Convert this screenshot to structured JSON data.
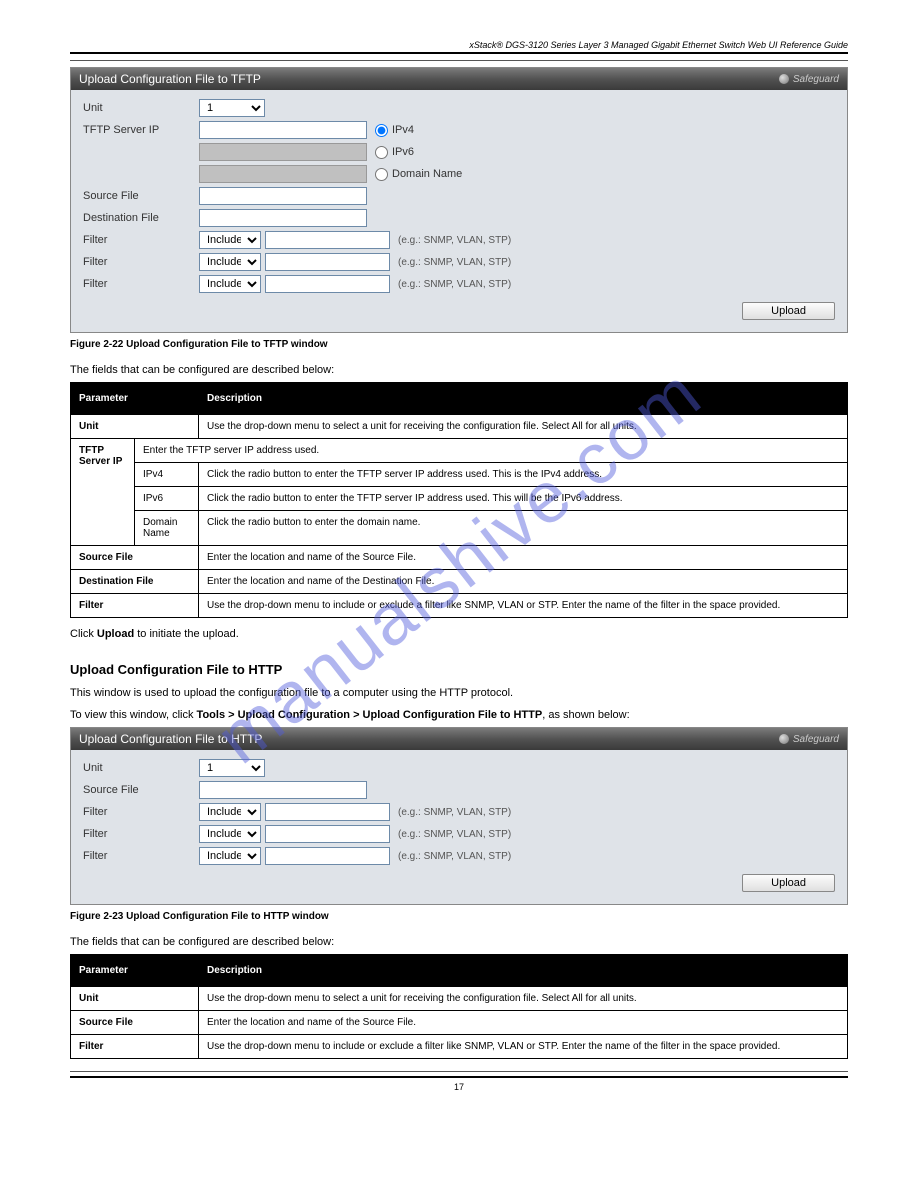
{
  "header": "xStack® DGS-3120 Series Layer 3 Managed Gigabit Ethernet Switch Web UI Reference Guide",
  "watermark": "manualshive.com",
  "panel1": {
    "title": "Upload Configuration File to TFTP",
    "safeguard": "Safeguard",
    "labels": {
      "unit": "Unit",
      "server": "TFTP Server IP",
      "src": "Source File",
      "dest": "Destination File",
      "filter": "Filter"
    },
    "unit_value": "1",
    "radios": {
      "ipv4": "IPv4",
      "ipv6": "IPv6",
      "domain": "Domain Name"
    },
    "filter_sel": "Include",
    "hint": "(e.g.: SNMP, VLAN, STP)",
    "btn": "Upload"
  },
  "figcap1": "Figure 2-22 Upload Configuration File to TFTP window",
  "desc1": "The fields that can be configured are described below:",
  "table1": {
    "h1": "Parameter",
    "h2": "Description",
    "r_unit_p": "Unit",
    "r_unit_d": "Use the drop-down menu to select a unit for receiving the configuration file. Select All for all units.",
    "r_srv_p": "TFTP Server IP",
    "r_srv_d": "Enter the TFTP server IP address used.",
    "r_ipv4_p": "IPv4",
    "r_ipv4_d": "Click the radio button to enter the TFTP server IP address used. This is the IPv4 address.",
    "r_ipv6_p": "IPv6",
    "r_ipv6_d": "Click the radio button to enter the TFTP server IP address used. This will be the IPv6 address.",
    "r_dom_p": "Domain Name",
    "r_dom_d": "Click the radio button to enter the domain name.",
    "r_src_p": "Source File",
    "r_src_d": "Enter the location and name of the Source File.",
    "r_dest_p": "Destination File",
    "r_dest_d": "Enter the location and name of the Destination File.",
    "r_filt_p": "Filter",
    "r_filt_d": "Use the drop-down menu to include or exclude a filter like SNMP, VLAN or STP. Enter the name of the filter in the space provided."
  },
  "para1": "Click Upload to initiate the upload.",
  "section1": {
    "title": "Upload Configuration File to HTTP",
    "intro": "This window is used to upload the configuration file to a computer using the HTTP protocol.",
    "nav": "To view this window, click Tools > Upload Configuration > Upload Configuration File to HTTP, as shown below:"
  },
  "panel2": {
    "title": "Upload Configuration File to HTTP",
    "safeguard": "Safeguard",
    "labels": {
      "unit": "Unit",
      "src": "Source File",
      "filter": "Filter"
    },
    "unit_value": "1",
    "filter_sel": "Include",
    "hint": "(e.g.: SNMP, VLAN, STP)",
    "btn": "Upload"
  },
  "figcap2": "Figure 2-23 Upload Configuration File to HTTP window",
  "desc2": "The fields that can be configured are described below:",
  "table2": {
    "h1": "Parameter",
    "h2": "Description",
    "r_unit_p": "Unit",
    "r_unit_d": "Use the drop-down menu to select a unit for receiving the configuration file. Select All for all units.",
    "r_src_p": "Source File",
    "r_src_d": "Enter the location and name of the Source File.",
    "r_filt_p": "Filter",
    "r_filt_d": "Use the drop-down menu to include or exclude a filter like SNMP, VLAN or STP. Enter the name of the filter in the space provided."
  },
  "footer": "17"
}
